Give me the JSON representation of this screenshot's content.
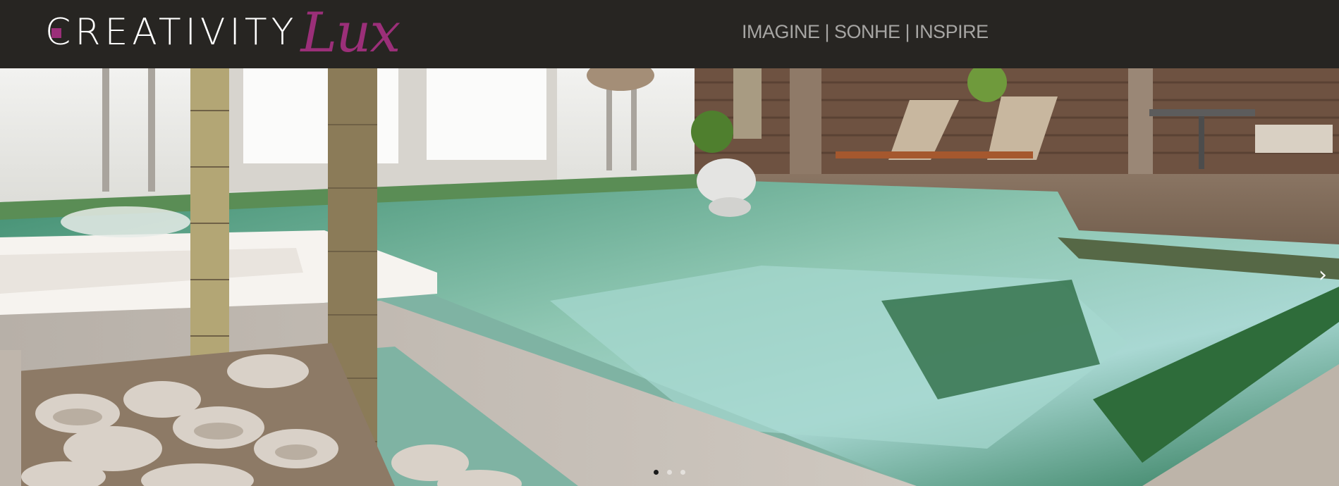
{
  "header": {
    "logo": {
      "main_text": "REATIVITY",
      "first_letter": "C",
      "script_text": "Lux"
    },
    "tagline": "IMAGINE | SONHE | INSPIRE"
  },
  "slider": {
    "next_icon": "chevron-right-icon",
    "next_glyph": "›",
    "slide_count": 3,
    "active_slide": 1,
    "image_alt": "Pool with green mosaic tiles, wooden deck, lounge chairs and palm trunks"
  },
  "colors": {
    "header_bg": "#272522",
    "brand_accent": "#9b2f79",
    "tagline": "#a6a5a3"
  }
}
